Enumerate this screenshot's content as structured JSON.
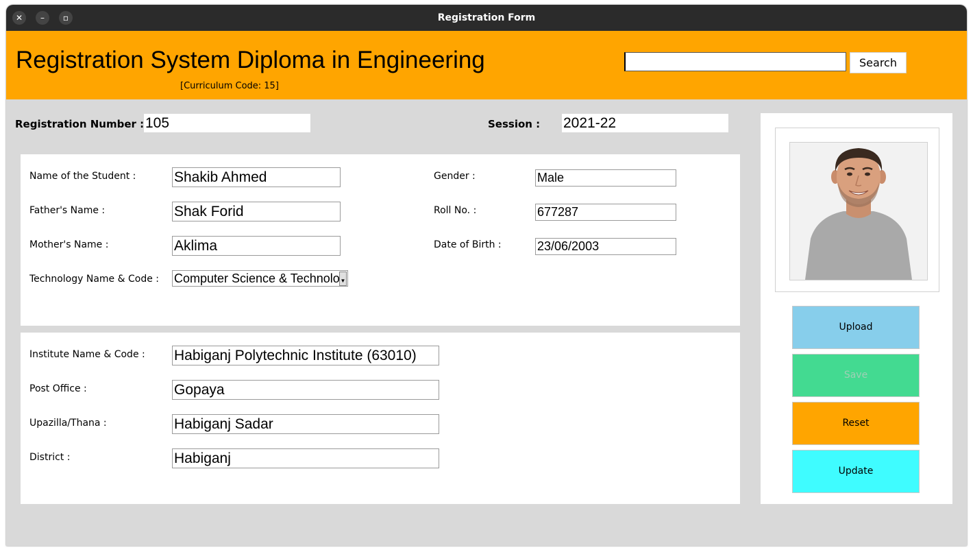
{
  "window": {
    "title": "Registration Form",
    "close_glyph": "✕",
    "minimize_glyph": "–",
    "maximize_glyph": "▫"
  },
  "header": {
    "title": "Registration System Diploma in Engineering",
    "subtitle": "[Curriculum Code: 15]",
    "search_value": "",
    "search_button": "Search"
  },
  "top_fields": {
    "registration_label": "Registration Number :",
    "registration_value": "105",
    "session_label": "Session :",
    "session_value": "2021-22"
  },
  "student": {
    "name_label": "Name of the Student :",
    "name_value": "Shakib Ahmed",
    "father_label": "Father's Name :",
    "father_value": "Shak Forid",
    "mother_label": "Mother's Name :",
    "mother_value": "Aklima",
    "technology_label": "Technology Name & Code :",
    "technology_value": "Computer Science & Technolo",
    "gender_label": "Gender :",
    "gender_value": "Male",
    "roll_label": "Roll No. :",
    "roll_value": "677287",
    "dob_label": "Date of Birth :",
    "dob_value": "23/06/2003"
  },
  "institute": {
    "institute_label": "Institute Name & Code :",
    "institute_value": "Habiganj Polytechnic Institute (63010)",
    "post_label": "Post Office :",
    "post_value": "Gopaya",
    "upazilla_label": "Upazilla/Thana :",
    "upazilla_value": "Habiganj Sadar",
    "district_label": "District :",
    "district_value": "Habiganj"
  },
  "actions": {
    "upload": "Upload",
    "save": "Save",
    "reset": "Reset",
    "update": "Update"
  },
  "colors": {
    "header_bg": "#ffa500",
    "upload_bg": "#87ceeb",
    "save_bg": "#43da91",
    "save_text_disabled": "#9fcfb5",
    "reset_bg": "#ffa500",
    "update_bg": "#3ffcff"
  },
  "icons": {
    "close": "close-icon",
    "minimize": "minimize-icon",
    "maximize": "maximize-icon",
    "dropdown": "chevron-down-icon"
  }
}
